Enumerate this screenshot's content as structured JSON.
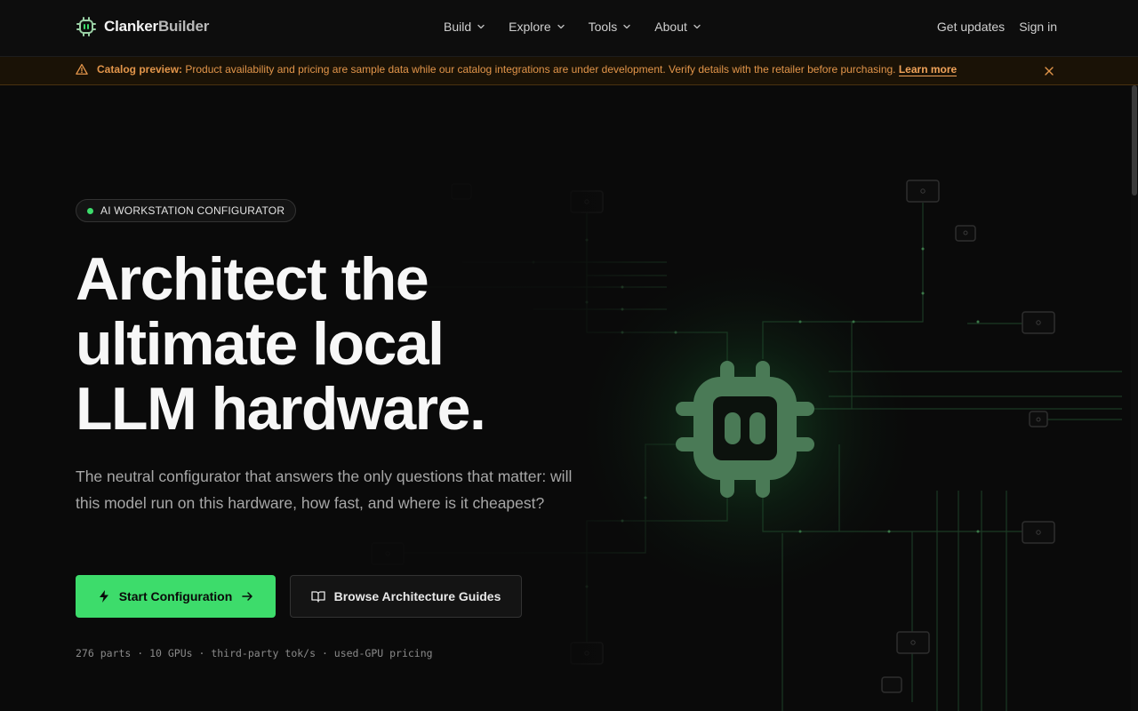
{
  "brand": {
    "name_primary": "Clanker",
    "name_secondary": "Builder"
  },
  "nav": {
    "menu": [
      {
        "label": "Build"
      },
      {
        "label": "Explore"
      },
      {
        "label": "Tools"
      },
      {
        "label": "About"
      }
    ],
    "get_updates": "Get updates",
    "sign_in": "Sign in"
  },
  "banner": {
    "title": "Catalog preview:",
    "message": "Product availability and pricing are sample data while our catalog integrations are under development. Verify details with the retailer before purchasing.",
    "link": "Learn more"
  },
  "hero": {
    "badge": "AI WORKSTATION CONFIGURATOR",
    "headline": [
      "Architect the",
      "ultimate local",
      "LLM hardware."
    ],
    "subtitle": "The neutral configurator that answers the only questions that matter: will this model run on this hardware, how fast, and where is it cheapest?",
    "primary_button": "Start Configuration",
    "secondary_button": "Browse Architecture Guides",
    "stats": "276 parts · 10 GPUs · third-party tok/s · used-GPU pricing"
  },
  "colors": {
    "accent": "#3ddc6b",
    "banner_text": "#e2954a",
    "background": "#0a0a0a"
  },
  "icons": {
    "logo": "chip-robot-icon",
    "banner": "warning-triangle-icon",
    "close": "close-icon",
    "primary_button": "lightning-bolt-icon",
    "primary_arrow": "arrow-right-icon",
    "secondary_button": "open-book-icon"
  }
}
